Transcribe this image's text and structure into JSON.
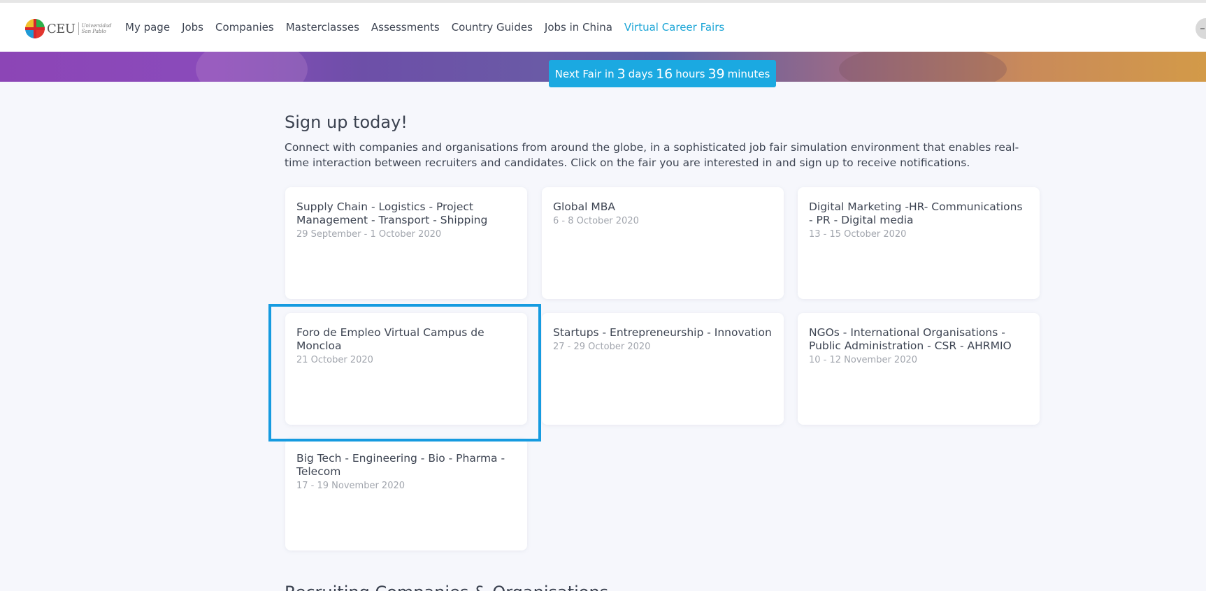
{
  "logo": {
    "text": "CEU",
    "sub_line1": "Universidad",
    "sub_line2": "San Pablo"
  },
  "nav": [
    {
      "label": "My page",
      "active": false
    },
    {
      "label": "Jobs",
      "active": false
    },
    {
      "label": "Companies",
      "active": false
    },
    {
      "label": "Masterclasses",
      "active": false
    },
    {
      "label": "Assessments",
      "active": false
    },
    {
      "label": "Country Guides",
      "active": false
    },
    {
      "label": "Jobs in China",
      "active": false
    },
    {
      "label": "Virtual Career Fairs",
      "active": true
    }
  ],
  "countdown": {
    "prefix": "Next Fair in",
    "days": "3",
    "days_label": "days",
    "hours": "16",
    "hours_label": "hours",
    "minutes": "39",
    "minutes_label": "minutes"
  },
  "main": {
    "heading": "Sign up today!",
    "intro": "Connect with companies and organisations from around the globe, in a sophisticated job fair simulation environment that enables real-time interaction between recruiters and candidates. Click on the fair you are interested in and sign up to receive notifications.",
    "next_heading": "Recruiting Companies & Organisations"
  },
  "fairs": [
    {
      "title": "Supply Chain - Logistics - Project Management - Transport - Shipping",
      "date": "29 September - 1 October 2020"
    },
    {
      "title": "Global MBA",
      "date": "6 - 8 October 2020"
    },
    {
      "title": "Digital Marketing -HR- Communications - PR - Digital media",
      "date": "13 - 15 October 2020"
    },
    {
      "title": "Foro de Empleo Virtual Campus de Moncloa",
      "date": "21 October 2020"
    },
    {
      "title": "Startups - Entrepreneurship - Innovation",
      "date": "27 - 29 October 2020"
    },
    {
      "title": "NGOs - International Organisations - Public Administration - CSR - AHRMIO",
      "date": "10 - 12 November 2020"
    },
    {
      "title": "Big Tech - Engineering - Bio - Pharma - Telecom",
      "date": "17 - 19 November 2020"
    }
  ],
  "colors": {
    "accent": "#1ba9e1",
    "highlight_border": "#169be0",
    "page_bg": "#f6f7fc"
  }
}
